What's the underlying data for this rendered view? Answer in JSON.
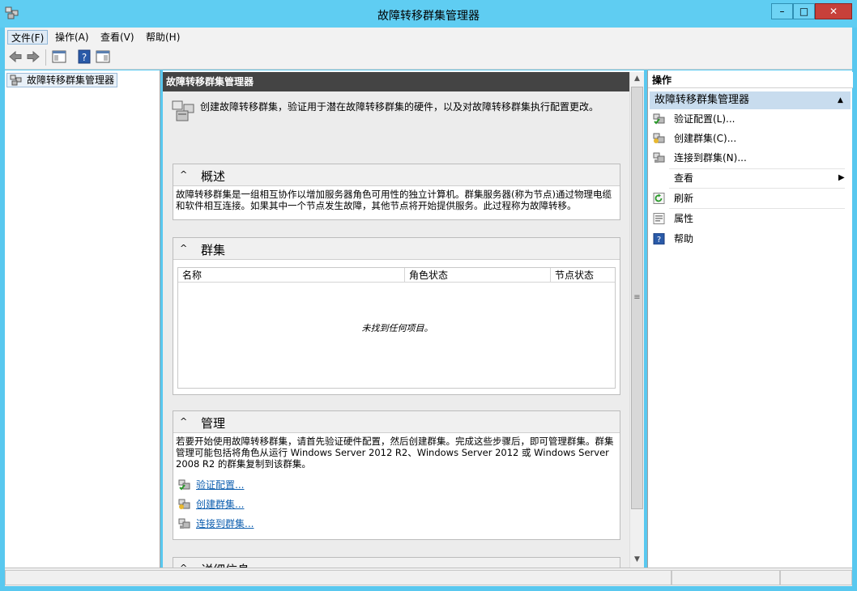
{
  "window": {
    "title": "故障转移群集管理器",
    "min_label": "–",
    "max_label": "□",
    "close_label": "✕"
  },
  "menu": {
    "file": "文件(F)",
    "action": "操作(A)",
    "view": "查看(V)",
    "help": "帮助(H)"
  },
  "toolbar": {
    "back_icon": "arrow-left-icon",
    "forward_icon": "arrow-right-icon",
    "console_tree_icon": "console-tree-icon",
    "help_icon": "help-icon",
    "action_pane_icon": "action-pane-icon"
  },
  "tree": {
    "root_label": "故障转移群集管理器"
  },
  "center": {
    "header": "故障转移群集管理器",
    "intro": "创建故障转移群集，验证用于潜在故障转移群集的硬件，以及对故障转移群集执行配置更改。",
    "overview": {
      "title": "概述",
      "text": "故障转移群集是一组相互协作以增加服务器角色可用性的独立计算机。群集服务器(称为节点)通过物理电缆和软件相互连接。如果其中一个节点发生故障，其他节点将开始提供服务。此过程称为故障转移。"
    },
    "clusters": {
      "title": "群集",
      "columns": [
        "名称",
        "角色状态",
        "节点状态"
      ],
      "empty_message": "未找到任何项目。"
    },
    "management": {
      "title": "管理",
      "text": "若要开始使用故障转移群集，请首先验证硬件配置，然后创建群集。完成这些步骤后，即可管理群集。群集管理可能包括将角色从运行 Windows Server 2012 R2、Windows Server 2012 或 Windows Server 2008 R2 的群集复制到该群集。",
      "links": [
        "验证配置...",
        "创建群集...",
        "连接到群集..."
      ]
    },
    "details": {
      "title": "详细信息"
    }
  },
  "actions": {
    "header": "操作",
    "group": "故障转移群集管理器",
    "items": [
      "验证配置(L)...",
      "创建群集(C)...",
      "连接到群集(N)...",
      "查看",
      "刷新",
      "属性",
      "帮助"
    ]
  },
  "colors": {
    "titlebar": "#5fcdf2",
    "close_button": "#c7403a",
    "section_header": "#444444",
    "link": "#1060b0",
    "actions_group": "#c8dcee"
  }
}
